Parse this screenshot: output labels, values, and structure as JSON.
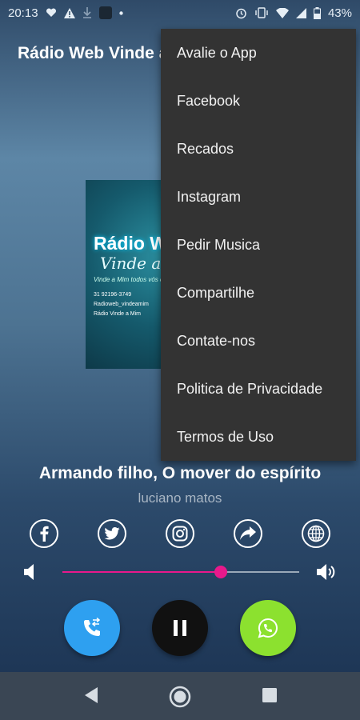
{
  "status_bar": {
    "time": "20:13",
    "battery": "43%"
  },
  "app": {
    "title": "Rádio Web Vinde a Mim"
  },
  "album": {
    "title": "Rádio Web",
    "subtitle": "Vinde a Mim",
    "tagline": "Vinde a Mim todos vós que estais cansados",
    "info": [
      "31 92196-3749",
      "Radioweb_vindeamim",
      "Rádio Vinde a Mim"
    ]
  },
  "menu": {
    "items": [
      "Avalie o App",
      "Facebook",
      "Recados",
      "Instagram",
      "Pedir Musica",
      "Compartilhe",
      "Contate-nos",
      "Politica de Privacidade",
      "Termos de Uso"
    ]
  },
  "player": {
    "song_title": "Armando filho, O mover do espírito",
    "artist": "luciano matos",
    "volume": 0.67
  },
  "colors": {
    "accent": "#e8198b",
    "call_button": "#2ea0f0",
    "play_button": "#111111",
    "whatsapp_button": "#8ce12f",
    "menu_bg": "#333333",
    "nav_bg": "#3a4654"
  },
  "icons": {
    "social": [
      "facebook-icon",
      "twitter-icon",
      "instagram-icon",
      "share-icon",
      "web-icon"
    ],
    "controls": [
      "call-icon",
      "pause-icon",
      "whatsapp-icon"
    ]
  }
}
